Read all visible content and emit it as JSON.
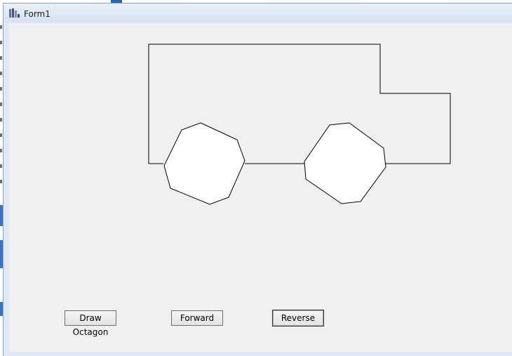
{
  "window": {
    "title": "Form1",
    "icon": "form-app-icon"
  },
  "buttons": {
    "draw_octagon": "Draw Octagon",
    "forward": "Forward",
    "reverse": "Reverse"
  },
  "colors": {
    "client_background": "#f0f0f0",
    "titlebar": "#dfe8f4",
    "outline": "#000000",
    "wheel_fill": "#ffffff"
  }
}
